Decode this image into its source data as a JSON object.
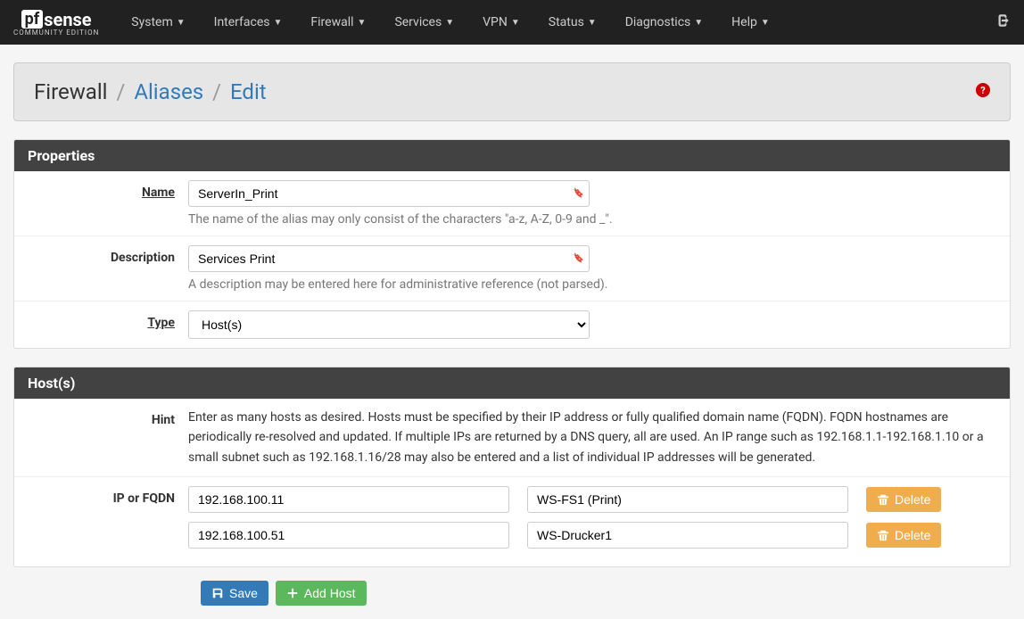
{
  "nav": {
    "items": [
      "System",
      "Interfaces",
      "Firewall",
      "Services",
      "VPN",
      "Status",
      "Diagnostics",
      "Help"
    ]
  },
  "breadcrumb": {
    "part1": "Firewall",
    "part2": "Aliases",
    "part3": "Edit"
  },
  "panels": {
    "properties_title": "Properties",
    "hosts_title": "Host(s)"
  },
  "labels": {
    "name": "Name",
    "description": "Description",
    "type": "Type",
    "hint": "Hint",
    "ip_or_fqdn": "IP or FQDN"
  },
  "values": {
    "name": "ServerIn_Print",
    "description": "Services Print",
    "type": "Host(s)"
  },
  "help": {
    "name": "The name of the alias may only consist of the characters \"a-z, A-Z, 0-9 and _\".",
    "description": "A description may be entered here for administrative reference (not parsed).",
    "hint": "Enter as many hosts as desired. Hosts must be specified by their IP address or fully qualified domain name (FQDN). FQDN hostnames are periodically re-resolved and updated. If multiple IPs are returned by a DNS query, all are used. An IP range such as 192.168.1.1-192.168.1.10 or a small subnet such as 192.168.1.16/28 may also be entered and a list of individual IP addresses will be generated."
  },
  "hosts": [
    {
      "ip": "192.168.100.11",
      "desc": "WS-FS1 (Print)"
    },
    {
      "ip": "192.168.100.51",
      "desc": "WS-Drucker1"
    }
  ],
  "buttons": {
    "delete": "Delete",
    "save": "Save",
    "add_host": "Add Host"
  },
  "logo": {
    "pf": "pf",
    "sense": "sense",
    "edition": "COMMUNITY EDITION"
  }
}
